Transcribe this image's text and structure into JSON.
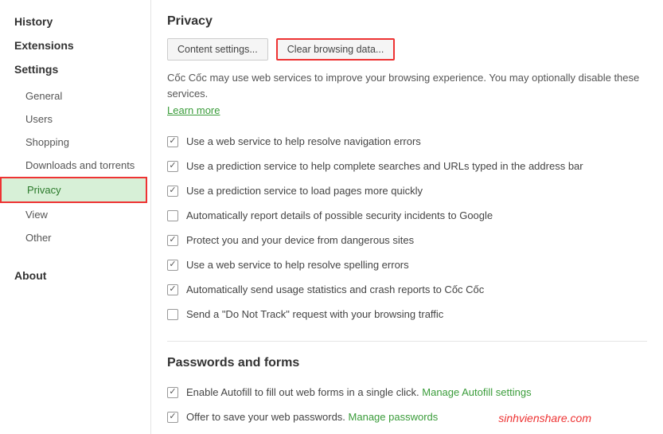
{
  "sidebar": {
    "top": [
      {
        "label": "History"
      },
      {
        "label": "Extensions"
      },
      {
        "label": "Settings"
      }
    ],
    "sub": [
      {
        "label": "General"
      },
      {
        "label": "Users"
      },
      {
        "label": "Shopping"
      },
      {
        "label": "Downloads and torrents"
      },
      {
        "label": "Privacy",
        "active": true
      },
      {
        "label": "View"
      },
      {
        "label": "Other"
      }
    ],
    "about": "About"
  },
  "privacy": {
    "title": "Privacy",
    "btn_content": "Content settings...",
    "btn_clear": "Clear browsing data...",
    "desc": "Cốc Cốc may use web services to improve your browsing experience. You may optionally disable these services.",
    "learn_more": "Learn more",
    "options": [
      {
        "label": "Use a web service to help resolve navigation errors",
        "checked": true
      },
      {
        "label": "Use a prediction service to help complete searches and URLs typed in the address bar",
        "checked": true
      },
      {
        "label": "Use a prediction service to load pages more quickly",
        "checked": true
      },
      {
        "label": "Automatically report details of possible security incidents to Google",
        "checked": false
      },
      {
        "label": "Protect you and your device from dangerous sites",
        "checked": true
      },
      {
        "label": "Use a web service to help resolve spelling errors",
        "checked": true
      },
      {
        "label": "Automatically send usage statistics and crash reports to Cốc Cốc",
        "checked": true
      },
      {
        "label": "Send a \"Do Not Track\" request with your browsing traffic",
        "checked": false
      }
    ]
  },
  "passwords": {
    "title": "Passwords and forms",
    "autofill_label": "Enable Autofill to fill out web forms in a single click. ",
    "autofill_link": "Manage Autofill settings",
    "savepw_label": "Offer to save your web passwords. ",
    "savepw_link": "Manage passwords"
  },
  "watermark": "sinhvienshare.com"
}
